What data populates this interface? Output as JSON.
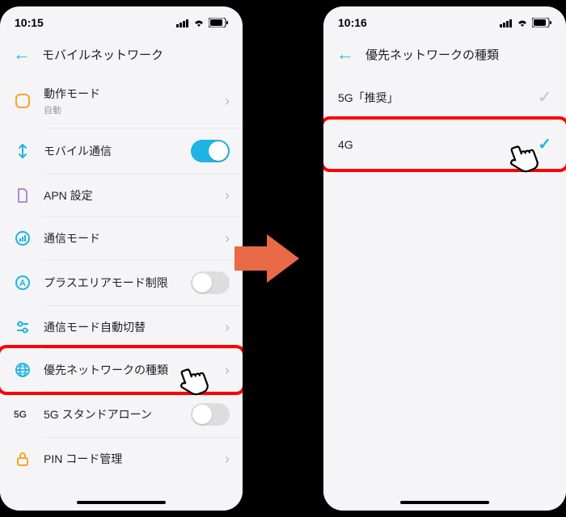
{
  "left": {
    "time": "10:15",
    "title": "モバイルネットワーク",
    "rows": [
      {
        "icon": "squircle",
        "label": "動作モード",
        "sublabel": "自動",
        "trail": "chev",
        "color": "#f5a623"
      },
      {
        "icon": "arrows",
        "label": "モバイル通信",
        "trail": "toggle-on",
        "color": "#1eb4e6"
      },
      {
        "icon": "sim",
        "label": "APN 設定",
        "trail": "chev",
        "color": "#b388d4"
      },
      {
        "icon": "signal",
        "label": "通信モード",
        "trail": "chev",
        "color": "#1eb4e6"
      },
      {
        "icon": "a-circle",
        "label": "プラスエリアモード制限",
        "trail": "toggle-off",
        "color": "#1eb4e6"
      },
      {
        "icon": "sliders",
        "label": "通信モード自動切替",
        "trail": "chev",
        "color": "#1eb4e6"
      },
      {
        "icon": "globe",
        "label": "優先ネットワークの種類",
        "trail": "chev",
        "color": "#1eb4e6",
        "highlight": true
      },
      {
        "icon": "5g",
        "label": "5G スタンドアローン",
        "trail": "toggle-off",
        "color": "#444"
      },
      {
        "icon": "lock",
        "label": "PIN コード管理",
        "trail": "chev",
        "color": "#f5a623"
      }
    ]
  },
  "right": {
    "time": "10:16",
    "title": "優先ネットワークの種類",
    "options": [
      {
        "label": "5G「推奨」",
        "selected": false
      },
      {
        "label": "4G",
        "selected": true,
        "highlight": true
      }
    ]
  }
}
